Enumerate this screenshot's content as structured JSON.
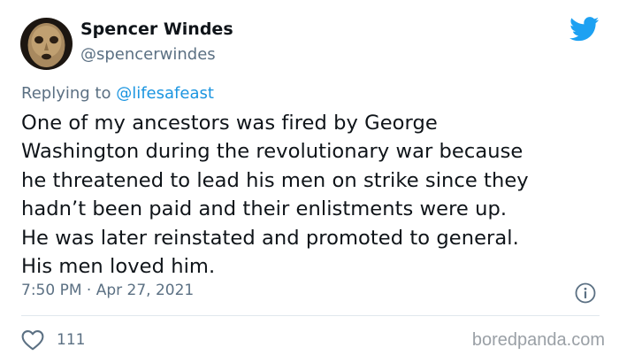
{
  "author": {
    "display_name": "Spencer Windes",
    "handle": "@spencerwindes",
    "avatar_icon": "stone-mask-avatar"
  },
  "reply": {
    "prefix": "Replying to",
    "target": "@lifesafeast"
  },
  "tweet": {
    "lines": [
      "One of my ancestors was fired by George",
      "Washington during the revolutionary war because",
      "he threatened to lead his men on strike since they",
      "hadn’t been paid and their enlistments were up.",
      "He was later reinstated and promoted to general.",
      "His men loved him."
    ],
    "timestamp": "7:50 PM · Apr 27, 2021",
    "likes": "111"
  },
  "icons": {
    "brand": "twitter-bird-icon",
    "info": "info-icon",
    "like": "heart-icon"
  },
  "colors": {
    "twitter_blue": "#1da1f2",
    "link_blue": "#1b95e0",
    "secondary_text": "#5b7083"
  },
  "watermark": "boredpanda.com"
}
